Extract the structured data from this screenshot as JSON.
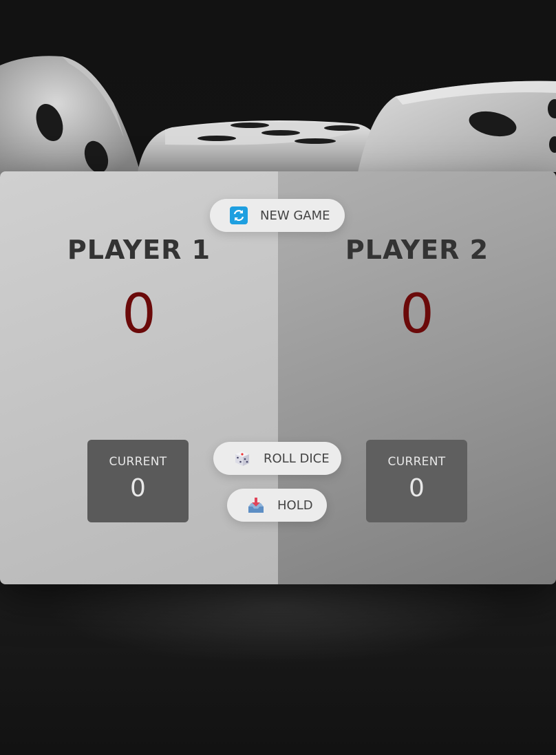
{
  "players": [
    {
      "name": "PLAYER 1",
      "score": "0",
      "current_label": "CURRENT",
      "current_score": "0",
      "active": true
    },
    {
      "name": "PLAYER 2",
      "score": "0",
      "current_label": "CURRENT",
      "current_score": "0",
      "active": false
    }
  ],
  "buttons": {
    "new_game": "NEW GAME",
    "roll_dice": "ROLL DICE",
    "hold": "HOLD"
  },
  "icons": {
    "new_game": "refresh-icon",
    "roll_dice": "dice-icon",
    "hold": "inbox-tray-icon"
  },
  "colors": {
    "score": "#6b0a0a",
    "current_box": "#5a5a5a",
    "active_panel": "#c8c8c8",
    "inactive_panel": "#999999",
    "refresh_icon": "#1e9fe0"
  }
}
